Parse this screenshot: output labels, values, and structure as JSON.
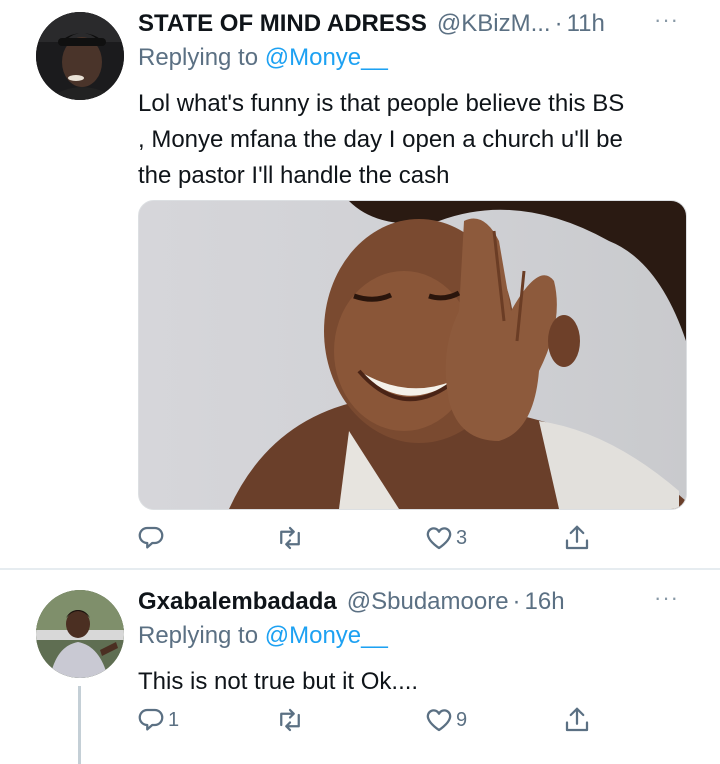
{
  "tweets": [
    {
      "author_name": "STATE OF MIND ADRESS",
      "handle": "@KBizM...",
      "separator": "·",
      "time": "11h",
      "more": "···",
      "replying_prefix": "Replying to",
      "replying_to": "@Monye__",
      "text_lines": [
        "Lol what's funny is that people believe this BS",
        ", Monye mfana the day I open a church u'll be",
        "the pastor I'll handle the cash"
      ],
      "reply_count": "",
      "retweet_count": "",
      "like_count": "3"
    },
    {
      "author_name": "Gxabalembadada",
      "handle": "@Sbudamoore",
      "separator": "·",
      "time": "16h",
      "more": "···",
      "replying_prefix": "Replying to",
      "replying_to": "@Monye__",
      "text_lines": [
        "This is not true but it Ok...."
      ],
      "reply_count": "1",
      "retweet_count": "",
      "like_count": "9"
    }
  ],
  "icons": [
    "reply-icon",
    "retweet-icon",
    "like-icon",
    "share-icon",
    "more-icon"
  ],
  "colors": {
    "link": "#1da1f2",
    "muted": "#5b7083",
    "text": "#0f1419"
  }
}
